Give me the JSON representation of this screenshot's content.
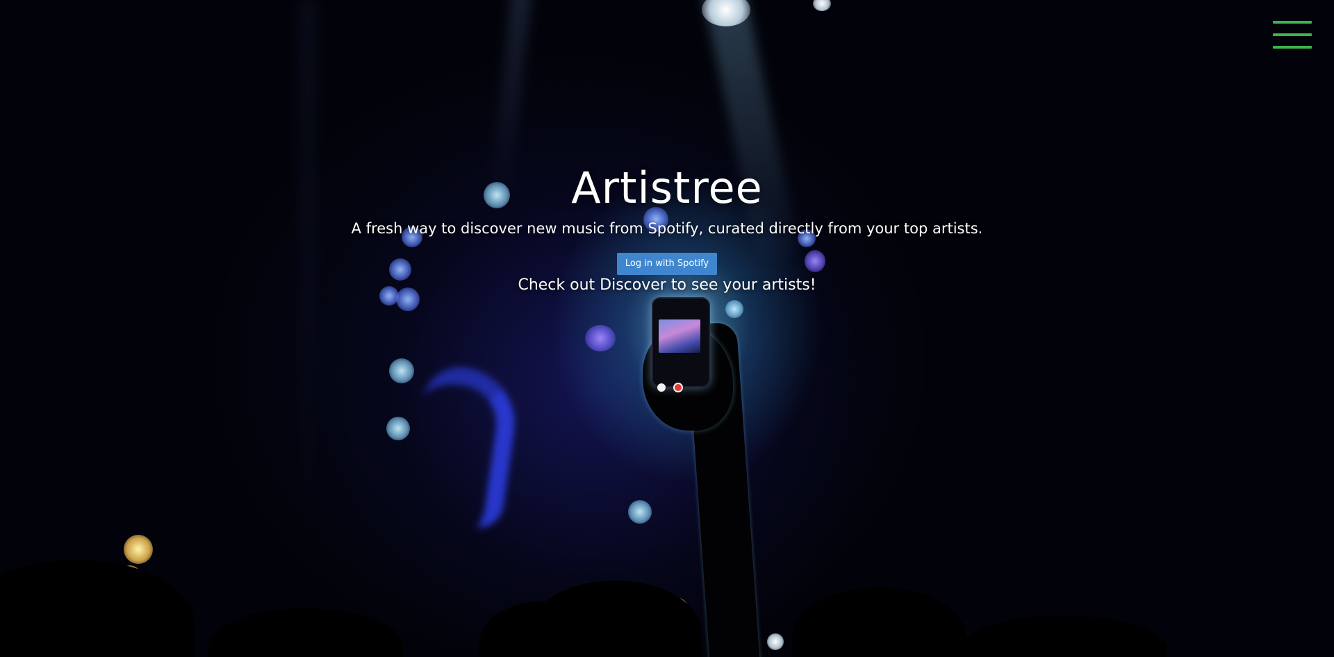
{
  "header": {
    "menu_icon": "hamburger-menu-icon",
    "menu_color": "#3cb54a"
  },
  "hero": {
    "title": "Artistree",
    "subtitle": "A fresh way to discover new music from Spotify, curated directly from your top artists.",
    "login_label": "Log in with Spotify",
    "note": "Check out Discover to see your artists!"
  },
  "colors": {
    "button": "#3f86cf",
    "text": "#ffffff",
    "menu": "#3cb54a"
  }
}
